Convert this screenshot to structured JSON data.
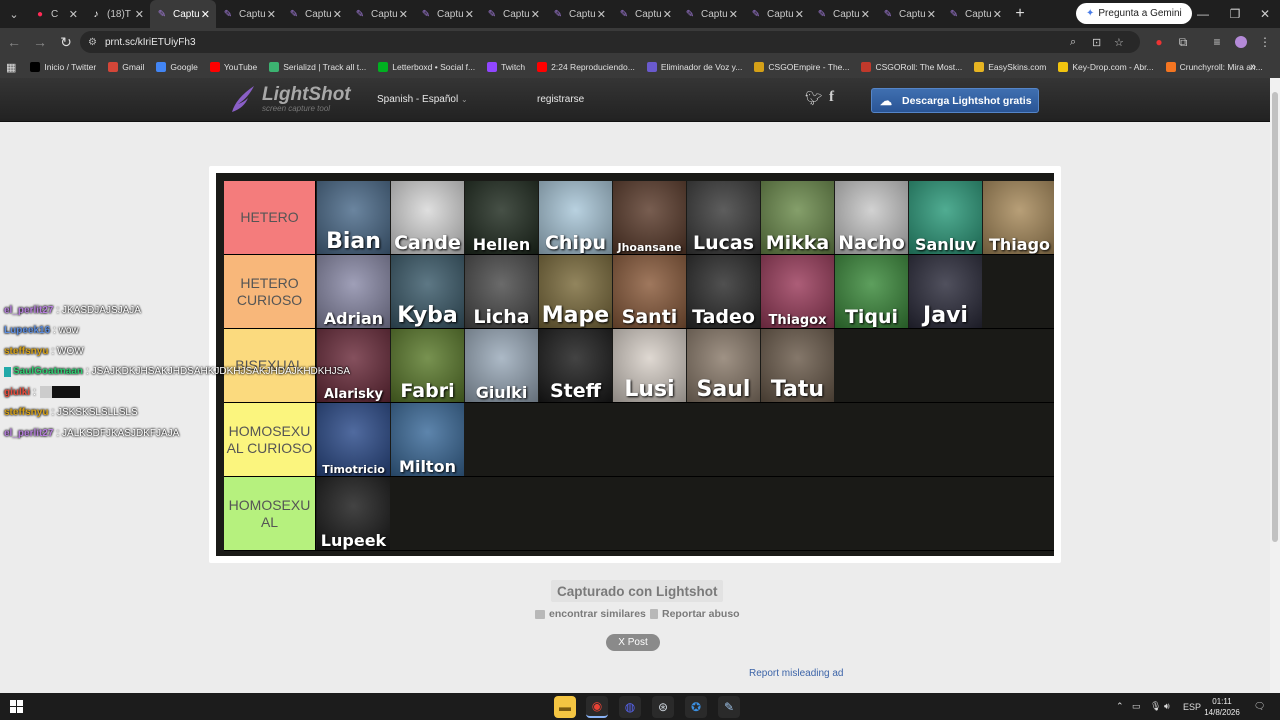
{
  "browser": {
    "tabs": [
      {
        "title": "C",
        "icon": "youtube-icon",
        "active": false
      },
      {
        "title": "(18)T",
        "icon": "tiktok-icon",
        "active": false
      },
      {
        "title": "Captu",
        "icon": "lightshot-icon",
        "active": true
      },
      {
        "title": "Captu",
        "icon": "lightshot-icon",
        "active": false
      },
      {
        "title": "Captu",
        "icon": "lightshot-icon",
        "active": false
      },
      {
        "title": "Captu",
        "icon": "lightshot-icon",
        "active": false
      },
      {
        "title": "Captu",
        "icon": "lightshot-icon",
        "active": false
      },
      {
        "title": "Captu",
        "icon": "lightshot-icon",
        "active": false
      },
      {
        "title": "Captu",
        "icon": "lightshot-icon",
        "active": false
      },
      {
        "title": "Captu",
        "icon": "lightshot-icon",
        "active": false
      },
      {
        "title": "Captu",
        "icon": "lightshot-icon",
        "active": false
      },
      {
        "title": "Captu",
        "icon": "lightshot-icon",
        "active": false
      },
      {
        "title": "Captu",
        "icon": "lightshot-icon",
        "active": false
      },
      {
        "title": "Captu",
        "icon": "lightshot-icon",
        "active": false
      },
      {
        "title": "Captu",
        "icon": "lightshot-icon",
        "active": false
      }
    ],
    "gemini_label": "Pregunta a Gemini",
    "url": "prnt.sc/kIriETUiyFh3",
    "bookmarks": [
      {
        "label": "Inicio / Twitter",
        "icon": "x-icon",
        "color": "#000000"
      },
      {
        "label": "Gmail",
        "icon": "gmail-icon",
        "color": "#d44638"
      },
      {
        "label": "Google",
        "icon": "google-icon",
        "color": "#4285f4"
      },
      {
        "label": "YouTube",
        "icon": "youtube-icon",
        "color": "#ff0000"
      },
      {
        "label": "Serializd | Track all t...",
        "icon": "serializd-icon",
        "color": "#3cb371"
      },
      {
        "label": "Letterboxd • Social f...",
        "icon": "letterboxd-icon",
        "color": "#00b020"
      },
      {
        "label": "Twitch",
        "icon": "twitch-icon",
        "color": "#9146ff"
      },
      {
        "label": "2:24 Reproduciendo...",
        "icon": "youtube-icon",
        "color": "#ff0000"
      },
      {
        "label": "Eliminador de Voz y...",
        "icon": "vocal-remover-icon",
        "color": "#6a5acd"
      },
      {
        "label": "CSGOEmpire - The...",
        "icon": "csgoempire-icon",
        "color": "#d4a017"
      },
      {
        "label": "CSGORoll: The Most...",
        "icon": "csgoroll-icon",
        "color": "#c0392b"
      },
      {
        "label": "EasySkins.com",
        "icon": "easyskins-icon",
        "color": "#e6b422"
      },
      {
        "label": "Key-Drop.com - Abr...",
        "icon": "keydrop-icon",
        "color": "#f1c40f"
      },
      {
        "label": "Crunchyroll: Mira an...",
        "icon": "crunchyroll-icon",
        "color": "#f47521"
      }
    ]
  },
  "lightshot": {
    "brand": "LightShot",
    "tagline": "screen capture tool",
    "language": "Spanish - Español",
    "register": "registrarse",
    "download": "Descarga Lightshot gratis",
    "caption": "Capturado con Lightshot",
    "find_similar": "encontrar similares",
    "report_abuse": "Reportar abuso",
    "x_post": "X Post",
    "report_ad": "Report misleading ad"
  },
  "tierlist": {
    "tiers": [
      {
        "label": "HETERO",
        "color": "#f47c7c",
        "items": [
          {
            "name": "Bian",
            "bg": "#4a6a8a"
          },
          {
            "name": "Cande",
            "bg": "#d8d8d8"
          },
          {
            "name": "Hellen",
            "bg": "#1e2a1e"
          },
          {
            "name": "Chipu",
            "bg": "#a9c7d9"
          },
          {
            "name": "Jhoansane",
            "bg": "#5a3a2a"
          },
          {
            "name": "Lucas",
            "bg": "#3a3a3a"
          },
          {
            "name": "Mikka",
            "bg": "#6a8a4a"
          },
          {
            "name": "Nacho",
            "bg": "#c8c8c8"
          },
          {
            "name": "Sanluv",
            "bg": "#2a9a7a"
          },
          {
            "name": "Thiago",
            "bg": "#a88a5a"
          }
        ]
      },
      {
        "label": "HETERO CURIOSO",
        "color": "#f8b77a",
        "items": [
          {
            "name": "Adrian",
            "bg": "#8a8aa8"
          },
          {
            "name": "Kyba",
            "bg": "#3a5a6a"
          },
          {
            "name": "Licha",
            "bg": "#4a4a4a"
          },
          {
            "name": "Mape",
            "bg": "#7a6a3a"
          },
          {
            "name": "Santi",
            "bg": "#8a5a3a"
          },
          {
            "name": "Tadeo",
            "bg": "#2a2a2a"
          },
          {
            "name": "Thiagox",
            "bg": "#9a3a5a"
          },
          {
            "name": "Tiqui",
            "bg": "#3a8a3a"
          },
          {
            "name": "Javi",
            "bg": "#2a2a3a"
          }
        ]
      },
      {
        "label": "BISEXUAL",
        "color": "#fbda7e",
        "items": [
          {
            "name": "Alarisky",
            "bg": "#6a2a3a"
          },
          {
            "name": "Fabri",
            "bg": "#5a7a2a"
          },
          {
            "name": "Giulki",
            "bg": "#9aaaba"
          },
          {
            "name": "Steff",
            "bg": "#1a1a1a"
          },
          {
            "name": "Lusi",
            "bg": "#d8d0c8"
          },
          {
            "name": "Saul",
            "bg": "#8a7a6a"
          },
          {
            "name": "Tatu",
            "bg": "#6a5a4a"
          }
        ]
      },
      {
        "label": "HOMOSEXU AL CURIOSO",
        "color": "#fbf57e",
        "items": [
          {
            "name": "Timotricio",
            "bg": "#2a4a8a"
          },
          {
            "name": "Milton",
            "bg": "#3a6a9a"
          }
        ]
      },
      {
        "label": "HOMOSEXU AL",
        "color": "#b6f17e",
        "items": [
          {
            "name": "Lupeek",
            "bg": "#1a1a1a"
          }
        ]
      }
    ]
  },
  "chat": [
    {
      "user": "el_perlit27",
      "color": "#b57edc",
      "message": ": JKASDJAJSJAJA"
    },
    {
      "user": "Lupeek16",
      "color": "#5b8de0",
      "message": ": wow"
    },
    {
      "user": "steffsnyu",
      "color": "#d4a017",
      "message": ": WOW"
    },
    {
      "user": "SaulGoatmaan",
      "color": "#2ecc71",
      "message": ": JSAJKDKJHSAKJHDSAHKJDKHJSAKJHDAJKHDKHJSA",
      "badge": true
    },
    {
      "user": "giulki",
      "color": "#e74c3c",
      "message": ":",
      "image": true
    },
    {
      "user": "steffsnyu",
      "color": "#d4a017",
      "message": ": JSKSKSLSLLSLS"
    },
    {
      "user": "el_perlit27",
      "color": "#b57edc",
      "message": ": JALKSDFJKASJDKFJAJA"
    }
  ],
  "taskbar": {
    "apps": [
      "file-explorer-icon",
      "chrome-icon",
      "discord-icon",
      "steam-icon",
      "battlenet-icon",
      "lightshot-icon"
    ],
    "language": "ESP",
    "time": "01:11",
    "date": "14/8/2026"
  }
}
